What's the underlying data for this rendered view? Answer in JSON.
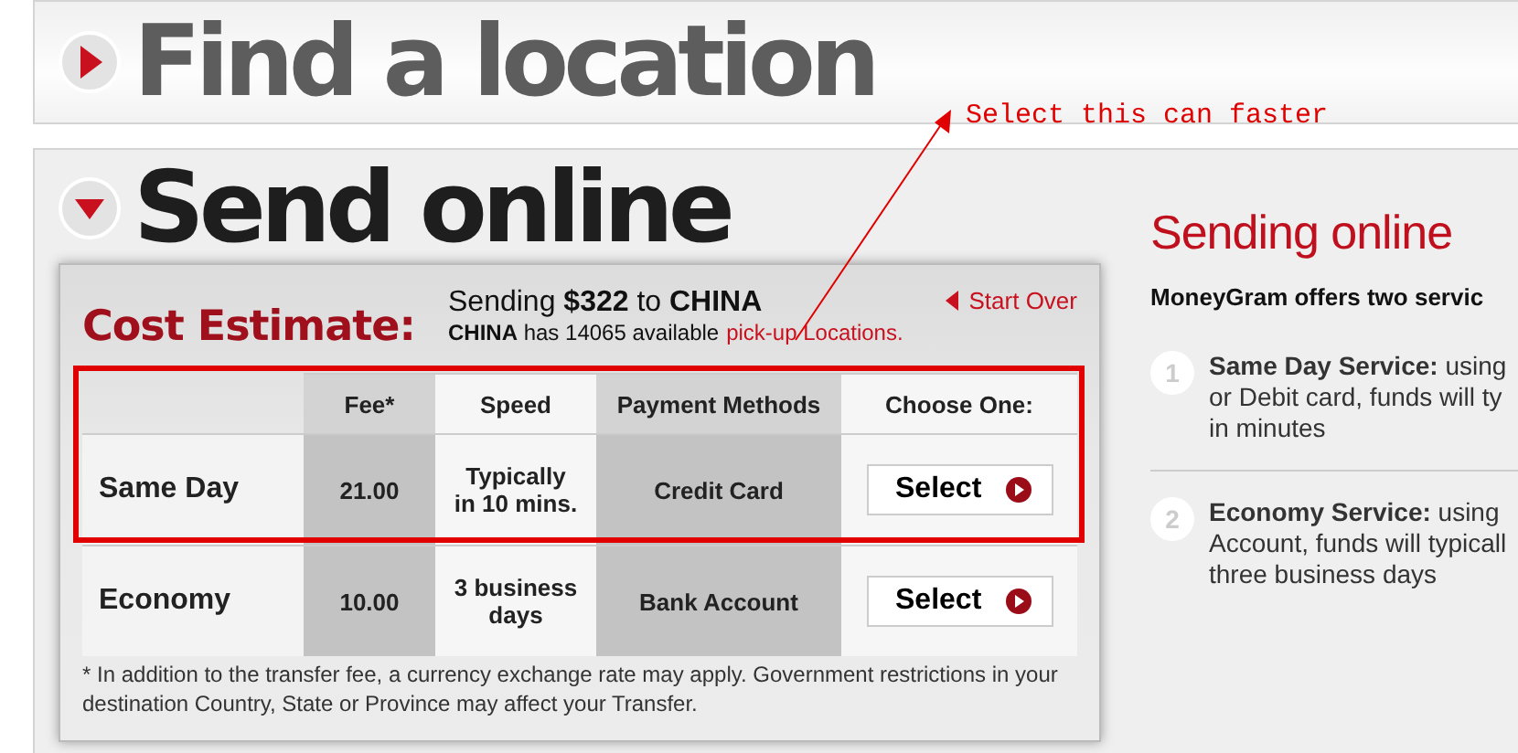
{
  "sections": [
    {
      "title": "Find a location",
      "expanded": false
    },
    {
      "title": "Send online",
      "expanded": true
    }
  ],
  "cost_estimate": {
    "title": "Cost Estimate:",
    "sending": "Sending **$322** to **CHINA**",
    "availability": "**CHINA** has 14065 available",
    "locations_link": "pick-up Locations.",
    "start_over": "Start Over",
    "columns": [
      "Fee*",
      "Speed",
      "Payment Methods",
      "Choose One:"
    ],
    "rows": [
      {
        "name": "Same Day",
        "fee": "21.00",
        "speed": "Typically in 10 mins.",
        "payment": "Credit Card",
        "button": "Select"
      },
      {
        "name": "Economy",
        "fee": "10.00",
        "speed": "3 business days",
        "payment": "Bank Account",
        "button": "Select"
      }
    ],
    "footnote": "* In addition to the transfer fee, a currency exchange rate may apply. Government restrictions in your destination Country, State or Province may affect your Transfer."
  },
  "info": {
    "title": "Sending online",
    "intro": "MoneyGram offers two servic",
    "services": [
      {
        "number": "1",
        "lines": [
          "**Same Day Service:** using",
          "or Debit card, funds will ty",
          "in minutes"
        ]
      },
      {
        "number": "2",
        "lines": [
          "**Economy Service:** using",
          "Account, funds will typicall",
          "three business days"
        ]
      }
    ]
  },
  "annotation": {
    "text": "Select this can faster"
  }
}
